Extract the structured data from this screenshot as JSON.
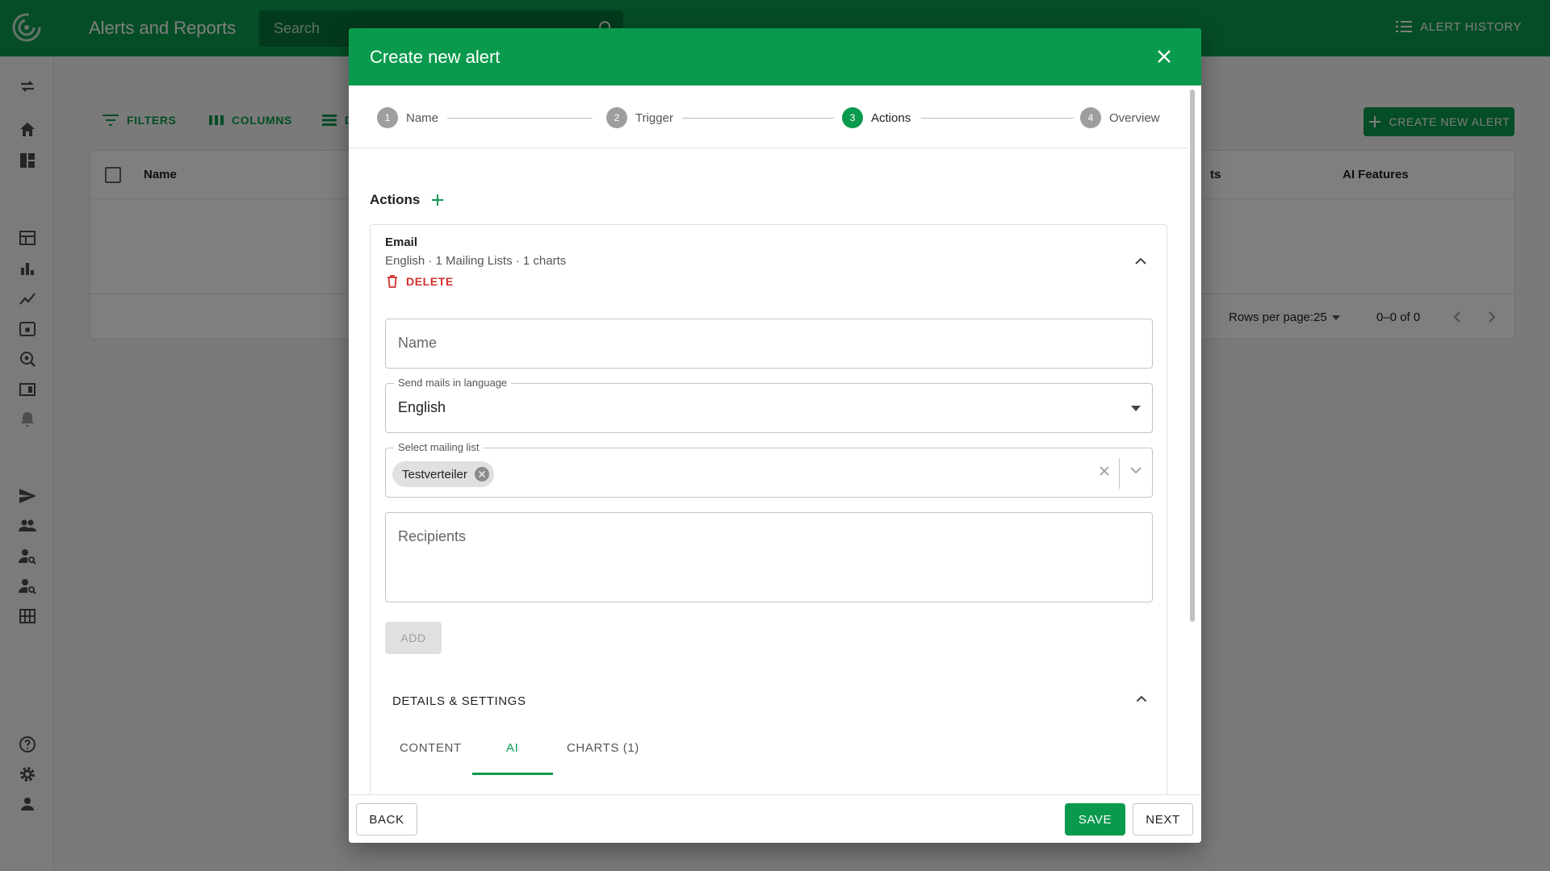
{
  "header": {
    "app_title": "Alerts and Reports",
    "search_placeholder": "Search",
    "alert_history_label": "ALERT HISTORY"
  },
  "toolbar": {
    "filters_label": "FILTERS",
    "columns_label": "COLUMNS",
    "density_label": "D",
    "create_label": "CREATE NEW ALERT"
  },
  "grid": {
    "columns": [
      "Name",
      "ts",
      "AI Features"
    ],
    "rows_per_page_label": "Rows per page:",
    "rows_per_page_value": "25",
    "pagination": "0–0 of 0"
  },
  "dialog": {
    "title": "Create new alert",
    "steps": [
      {
        "num": "1",
        "label": "Name"
      },
      {
        "num": "2",
        "label": "Trigger"
      },
      {
        "num": "3",
        "label": "Actions"
      },
      {
        "num": "4",
        "label": "Overview"
      }
    ],
    "active_step": 3,
    "actions_heading": "Actions",
    "card": {
      "type": "Email",
      "summary": "English · 1 Mailing Lists · 1 charts",
      "delete_label": "DELETE",
      "name_placeholder": "Name",
      "language_label": "Send mails in language",
      "language_value": "English",
      "mailing_label": "Select mailing list",
      "mailing_chip": "Testverteiler",
      "recipients_placeholder": "Recipients",
      "add_label": "ADD",
      "details_heading": "DETAILS & SETTINGS",
      "tabs": [
        "CONTENT",
        "AI",
        "CHARTS (1)"
      ],
      "active_tab": "AI"
    },
    "footer": {
      "back_label": "BACK",
      "save_label": "SAVE",
      "next_label": "NEXT"
    }
  },
  "colors": {
    "brand": "#0a9a4d",
    "danger": "#d32f2f"
  }
}
